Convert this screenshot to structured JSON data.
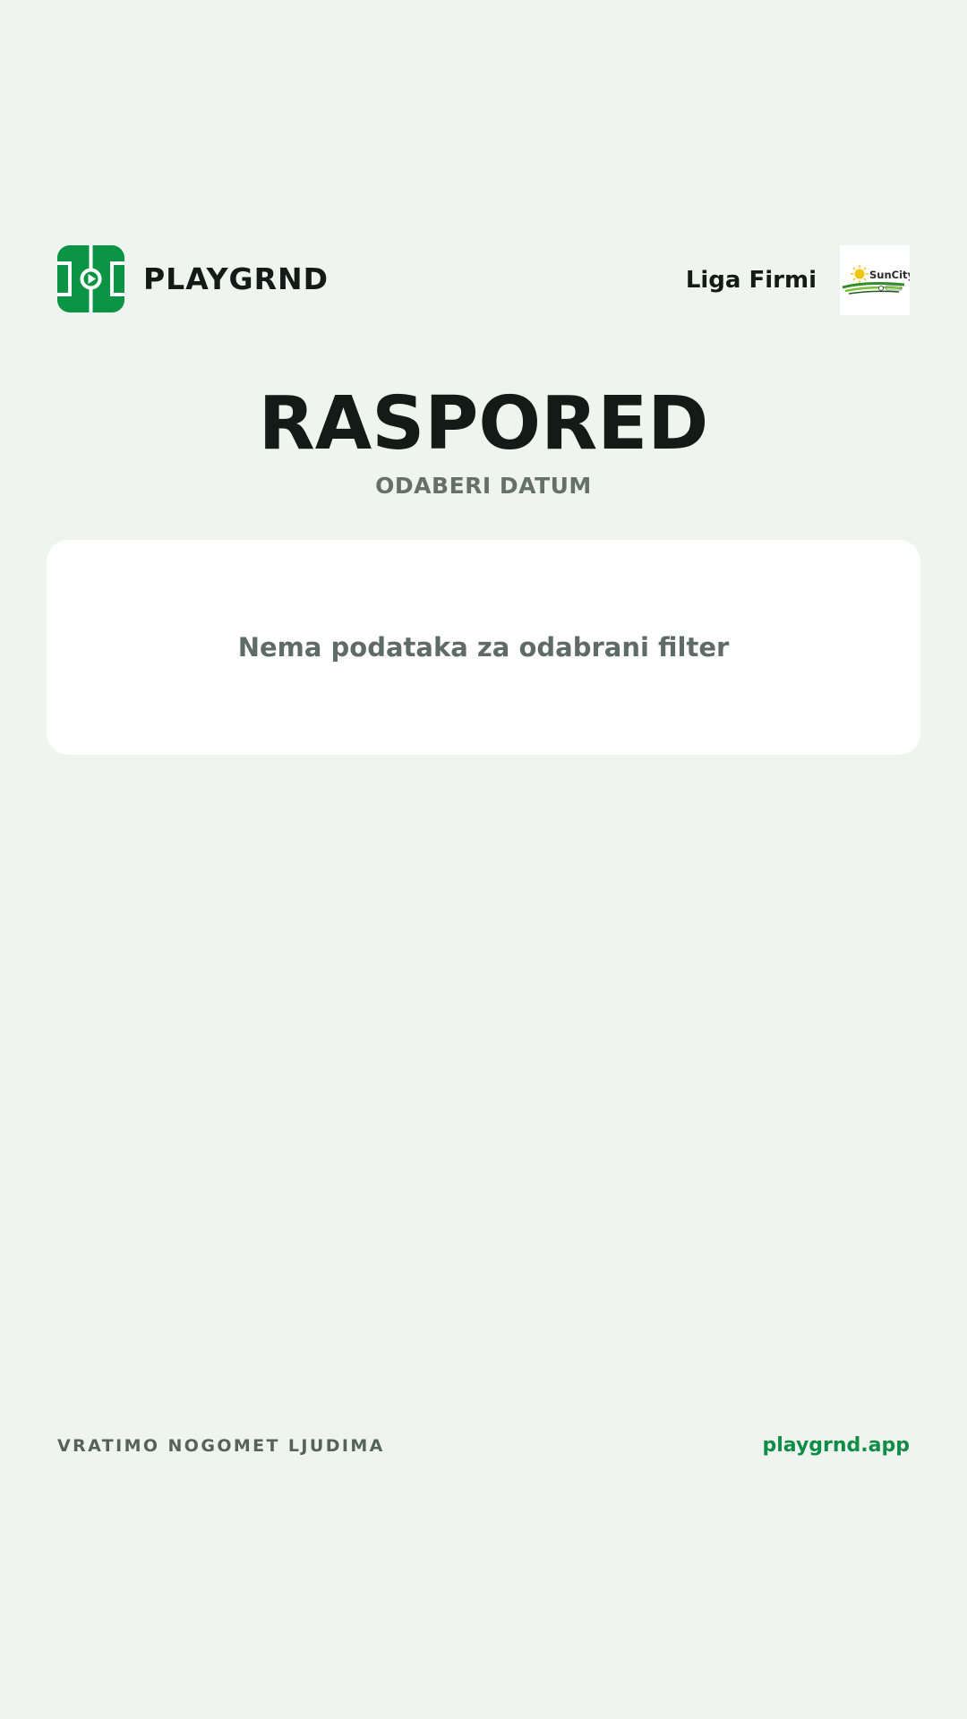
{
  "brand": {
    "name": "PLAYGRND",
    "logo_icon": "football-pitch-play-icon",
    "color": "#0a9444"
  },
  "league": {
    "name": "Liga Firmi",
    "sponsor_logo": "suncity-logo"
  },
  "page": {
    "title": "RASPORED",
    "subtitle": "ODABERI DATUM"
  },
  "schedule": {
    "empty_message": "Nema podataka za odabrani filter"
  },
  "footer": {
    "tagline": "VRATIMO NOGOMET LJUDIMA",
    "link": "playgrnd.app",
    "link_color": "#0f8c45"
  },
  "colors": {
    "background": "#eff4f0",
    "card": "#ffffff",
    "text_dark": "#141a17",
    "text_muted": "#66706b"
  }
}
